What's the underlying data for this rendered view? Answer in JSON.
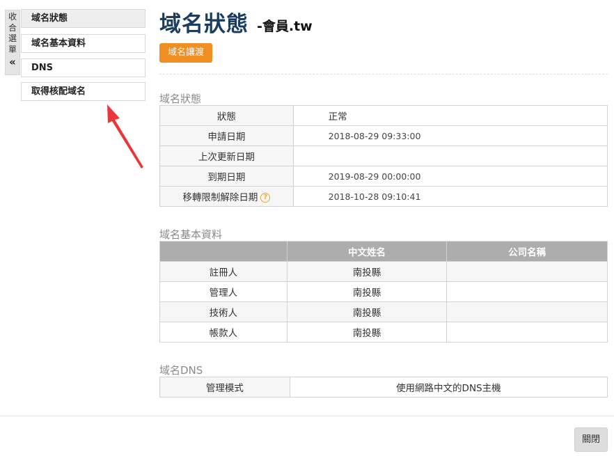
{
  "sidebar": {
    "collapse_chars": [
      "收",
      "合",
      "選",
      "單"
    ],
    "collapse_arrow": "«",
    "items": [
      {
        "label": "域名狀態"
      },
      {
        "label": "域名基本資料"
      },
      {
        "label": "DNS"
      },
      {
        "label": "取得核配域名"
      }
    ]
  },
  "header": {
    "title": "域名狀態",
    "subtitle": "-會員.tw",
    "transfer_button": "域名讓渡"
  },
  "status_section": {
    "heading": "域名狀態",
    "rows": [
      {
        "label": "狀態",
        "value": "正常"
      },
      {
        "label": "申請日期",
        "value": "2018-08-29 09:33:00"
      },
      {
        "label": "上次更新日期",
        "value": ""
      },
      {
        "label": "到期日期",
        "value": "2019-08-29 00:00:00"
      },
      {
        "label": "移轉限制解除日期",
        "value": "2018-10-28 09:10:41",
        "help_icon": "?"
      }
    ]
  },
  "basic_section": {
    "heading": "域名基本資料",
    "columns": [
      "",
      "中文姓名",
      "公司名稱"
    ],
    "rows": [
      {
        "role": "註冊人",
        "name": "南投縣",
        "company": ""
      },
      {
        "role": "管理人",
        "name": "南投縣",
        "company": ""
      },
      {
        "role": "技術人",
        "name": "南投縣",
        "company": ""
      },
      {
        "role": "帳款人",
        "name": "南投縣",
        "company": ""
      }
    ]
  },
  "dns_section": {
    "heading": "域名DNS",
    "label": "管理模式",
    "value": "使用網路中文的DNS主機"
  },
  "footer": {
    "close_button": "關閉"
  },
  "colors": {
    "title": "#1b3d60",
    "accent": "#ee8e23",
    "annotation": "#e8363a",
    "table_header": "#adadad"
  }
}
